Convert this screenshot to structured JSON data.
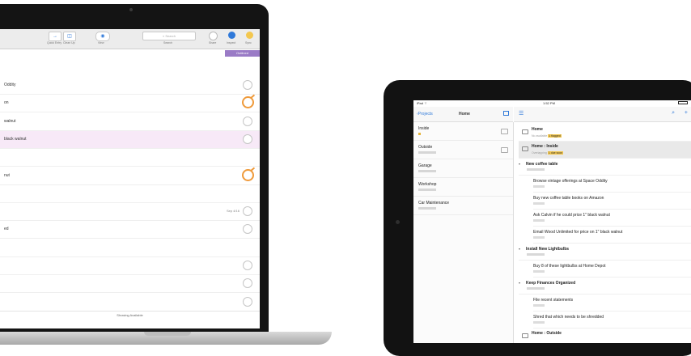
{
  "laptop": {
    "toolbar": {
      "buttons": [
        {
          "icon": "arrow-right-icon",
          "glyph": "→",
          "label": "Quick Entry"
        },
        {
          "icon": "inspector-icon",
          "glyph": "◫",
          "label": "Clean Up"
        },
        {
          "icon": "view-icon",
          "glyph": "◉",
          "label": "View"
        }
      ],
      "search_placeholder": "Search",
      "search_label": "Search",
      "right_buttons": [
        {
          "icon": "share-icon",
          "label": "Share"
        },
        {
          "icon": "inspect-icon",
          "label": "Inspect"
        },
        {
          "icon": "sync-icon",
          "label": "Sync"
        }
      ]
    },
    "purple_bar_label": "Outlined",
    "rows": [
      {
        "text": "Oddity",
        "mark": "circle"
      },
      {
        "text": "on",
        "mark": "flag"
      },
      {
        "text": "walnut",
        "mark": "circle"
      },
      {
        "text": "black walnut",
        "mark": "circle",
        "selected": true
      },
      {
        "text": "",
        "mark": ""
      },
      {
        "text": "nut",
        "mark": "flag"
      },
      {
        "text": "",
        "mark": ""
      },
      {
        "text": "",
        "mark": "circle",
        "side_value": "Sep 4/16"
      },
      {
        "text": "ed",
        "mark": "circle"
      },
      {
        "text": "",
        "mark": ""
      },
      {
        "text": "",
        "mark": "circle"
      },
      {
        "text": "",
        "mark": "circle"
      },
      {
        "text": "",
        "mark": "circle"
      }
    ],
    "footer": "Showing Available"
  },
  "ipad": {
    "status": {
      "left": "iPad ⌔",
      "center": "1:52 PM"
    },
    "sidebar_header": {
      "back": "Projects",
      "title": "Home"
    },
    "sidebar_items": [
      {
        "title": "Inside"
      },
      {
        "title": "Outside"
      },
      {
        "title": "Garage"
      },
      {
        "title": "Workshop"
      },
      {
        "title": "Car Maintenance"
      }
    ],
    "folders": [
      {
        "title": "Home",
        "sub_prefix": "No available",
        "badge": "1 flagged"
      },
      {
        "title": "Home : Inside",
        "sub_prefix": "Overlapping",
        "badge": "1 due soon"
      }
    ],
    "projects": [
      {
        "title": "New coffee table",
        "actions": [
          "Browse vintage offerings at Space Oddity",
          "Buy new coffee table books on Amazon",
          "Ask Calvin if he could price 1\" black walnut",
          "Email Wood Unlimited for price on 1\" black walnut"
        ]
      },
      {
        "title": "Install New Lightbulbs",
        "actions": [
          "Buy 8 of these lightbulbs at Home Depot"
        ]
      },
      {
        "title": "Keep Finances Organized",
        "actions": [
          "File recent statements",
          "Shred that which needs to be shredded"
        ]
      }
    ],
    "last_row": "Home : Outside"
  },
  "colors": {
    "accent_blue": "#2f79d9",
    "flag_orange": "#ef9a3a",
    "purple": "#9a7bc6",
    "due_yellow": "#f3c74f"
  }
}
